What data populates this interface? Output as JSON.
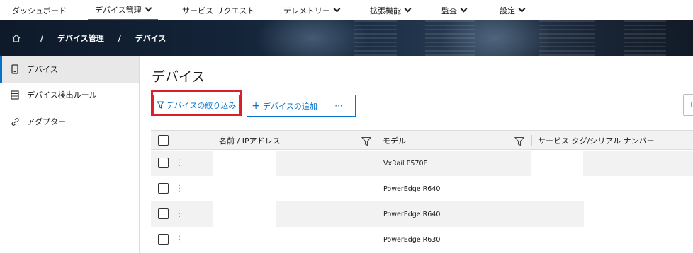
{
  "nav": {
    "items": [
      {
        "label": "ダッシュボード"
      },
      {
        "label": "デバイス管理"
      },
      {
        "label": "サービス リクエスト"
      },
      {
        "label": "テレメトリー"
      },
      {
        "label": "拡張機能"
      },
      {
        "label": "監査"
      },
      {
        "label": "設定"
      }
    ]
  },
  "breadcrumb": {
    "sep": "/",
    "level1": "デバイス管理",
    "level2": "デバイス"
  },
  "sidebar": {
    "items": [
      {
        "label": "デバイス",
        "icon": "phone-device-icon"
      },
      {
        "label": "デバイス検出ルール",
        "icon": "server-list-icon"
      },
      {
        "label": "アダプター",
        "icon": "link-icon"
      }
    ]
  },
  "main": {
    "title": "デバイス",
    "filter_button": "デバイスの絞り込み",
    "add_button": "デバイスの追加",
    "more_button": "···",
    "search_stub": "II"
  },
  "table": {
    "headers": {
      "name": "名前 / IPアドレス",
      "model": "モデル",
      "service_tag": "サービス タグ/シリアル ナンバー"
    },
    "rows": [
      {
        "name": "",
        "model": "VxRail P570F",
        "service_tag": ""
      },
      {
        "name": "",
        "model": "PowerEdge R640",
        "service_tag": ""
      },
      {
        "name": "",
        "model": "PowerEdge R640",
        "service_tag": ""
      },
      {
        "name": "",
        "model": "PowerEdge R630",
        "service_tag": ""
      }
    ]
  },
  "colors": {
    "accent": "#0672cb",
    "highlight": "#d7202c",
    "row_alt": "#f2f2f2"
  }
}
